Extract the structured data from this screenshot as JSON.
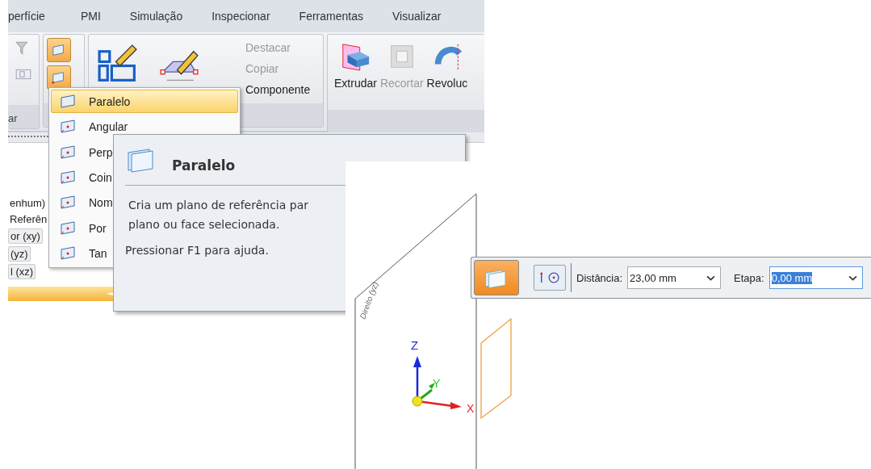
{
  "ribbon_tabs": [
    "perfície",
    "PMI",
    "Simulação",
    "Inspecionar",
    "Ferramentas",
    "Visualizar"
  ],
  "ribbon": {
    "group_label": "ar",
    "plane_buttons": [
      {
        "selected": true
      },
      {
        "selected": true
      }
    ],
    "edit_buttons": [
      {
        "label": "Destacar",
        "disabled": true
      },
      {
        "label": "Copiar",
        "disabled": true
      },
      {
        "label": "Componente",
        "disabled": false
      }
    ],
    "feature_buttons": [
      {
        "label": "Extrudar",
        "disabled": false,
        "kind": "extrude"
      },
      {
        "label": "Recortar",
        "disabled": true,
        "kind": "cut"
      },
      {
        "label": "Revoluc",
        "disabled": false,
        "kind": "revolve"
      }
    ]
  },
  "plane_menu": [
    {
      "label": "Paralelo",
      "selected": true
    },
    {
      "label": "Angular",
      "selected": false
    },
    {
      "label": "Perp",
      "selected": false
    },
    {
      "label": "Coin",
      "selected": false
    },
    {
      "label": "Nom",
      "selected": false
    },
    {
      "label": "Por",
      "selected": false
    },
    {
      "label": "Tan",
      "selected": false
    }
  ],
  "tooltip": {
    "title": "Paralelo",
    "lines": [
      "Cria um plano de referência par",
      "plano ou face selecionada."
    ],
    "help": "Pressionar F1 para ajuda."
  },
  "pathfinder_items": [
    {
      "label": "enhum)",
      "kind": "text"
    },
    {
      "label": "Referên",
      "kind": "text"
    },
    {
      "label": "or (xy)",
      "kind": "chip"
    },
    {
      "label": "(yz)",
      "kind": "chip"
    },
    {
      "label": "l (xz)",
      "kind": "chip"
    }
  ],
  "viewport": {
    "plane_label": "Direito (yz)",
    "axes": {
      "z": "Z",
      "y": "Y",
      "x": "X"
    }
  },
  "command_bar": {
    "mode_selected": true,
    "distance": {
      "label": "Distância:",
      "value": "23,00 mm"
    },
    "step": {
      "label": "Etapa:",
      "value": "0,00 mm",
      "highlighted": true
    }
  }
}
